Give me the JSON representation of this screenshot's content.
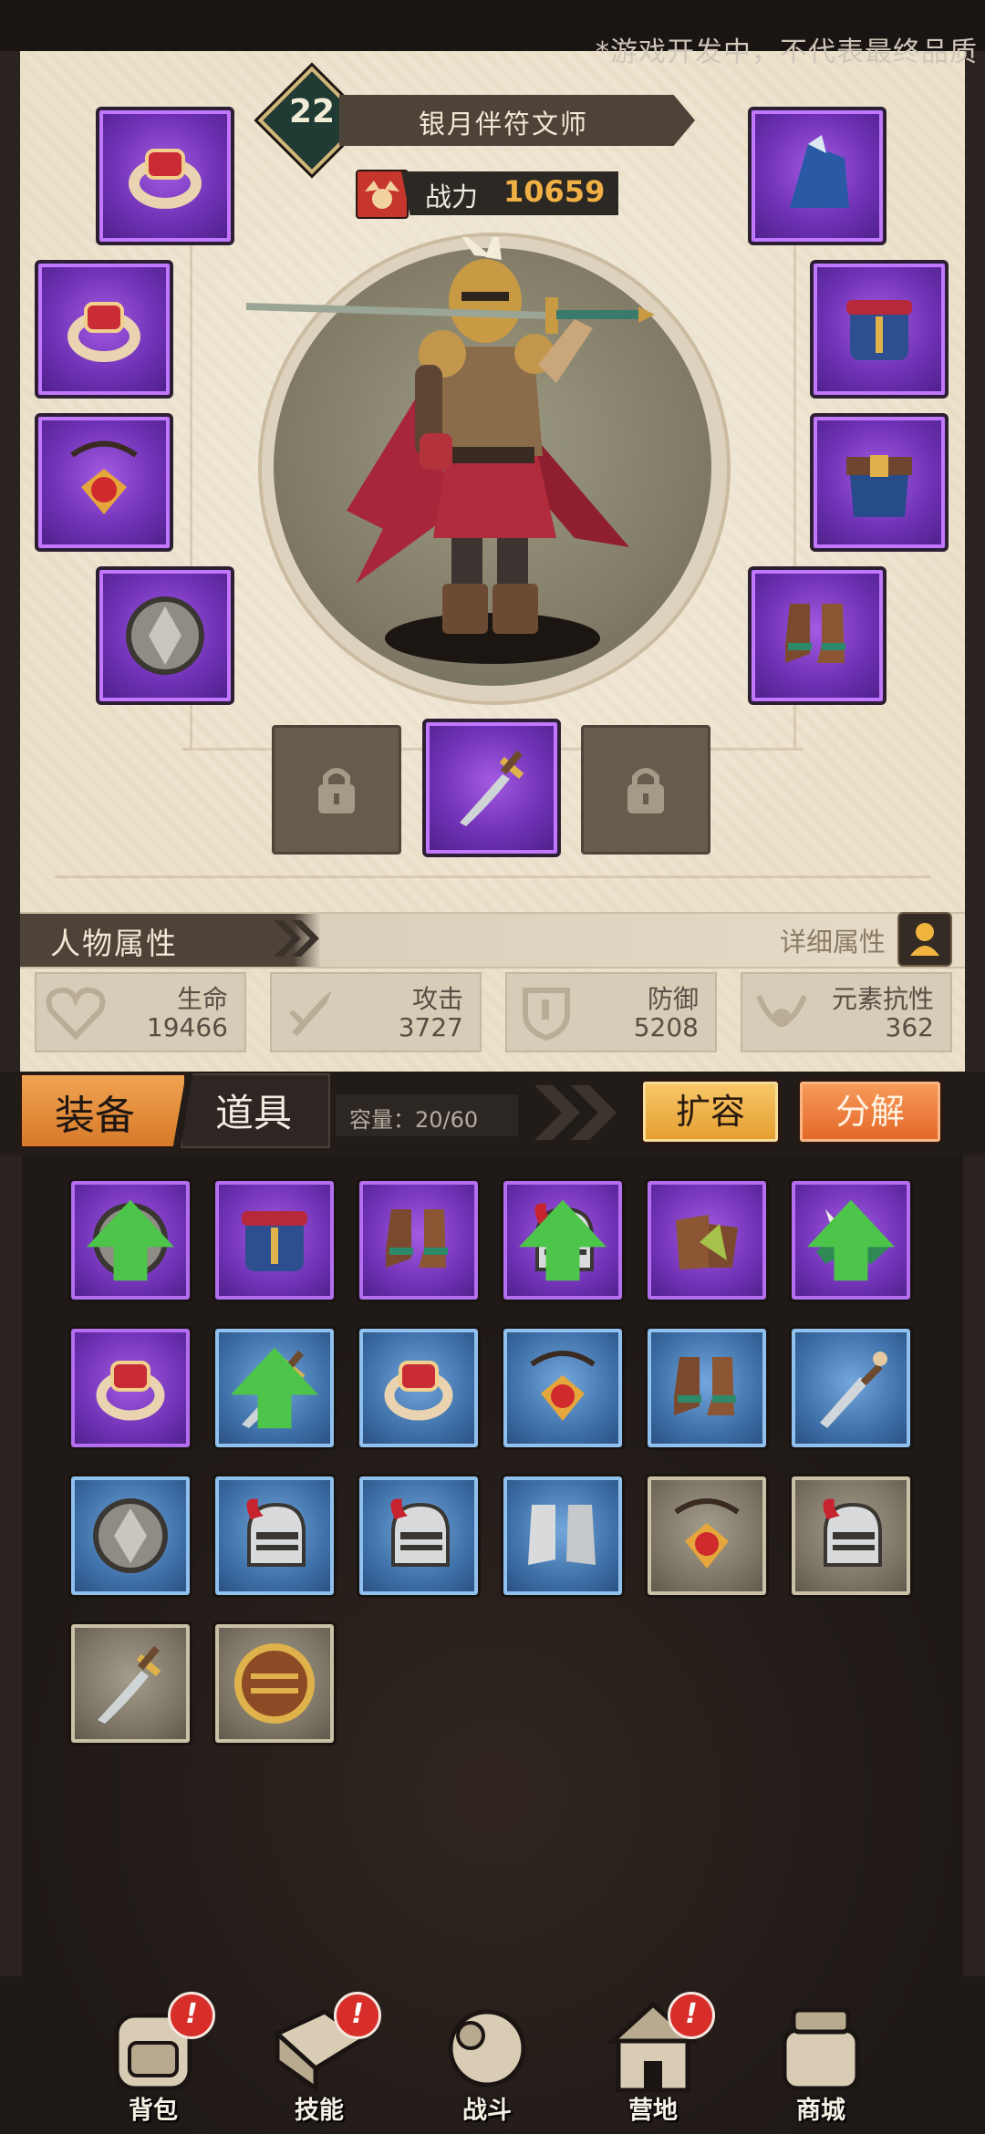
{
  "disclaimer": "*游戏开发中，不代表最终品质",
  "hero": {
    "level": "22",
    "name": "银月伴符文师",
    "power_label": "战力",
    "power_value": "10659"
  },
  "equipment_slots": {
    "left": [
      "ring-icon",
      "ring-icon",
      "amulet-icon",
      "shield-icon"
    ],
    "right": [
      "hood-icon",
      "chest-armor-icon",
      "belt-icon",
      "boots-icon"
    ],
    "bottom": [
      "locked",
      "sword-icon",
      "locked"
    ]
  },
  "attributes": {
    "title": "人物属性",
    "detail_label": "详细属性",
    "stats": [
      {
        "label": "生命",
        "value": "19466",
        "icon": "heart-icon"
      },
      {
        "label": "攻击",
        "value": "3727",
        "icon": "sword-attack-icon"
      },
      {
        "label": "防御",
        "value": "5208",
        "icon": "shield-defense-icon"
      },
      {
        "label": "元素抗性",
        "value": "362",
        "icon": "element-icon"
      }
    ]
  },
  "inventory": {
    "tab_equip": "装备",
    "tab_items": "道具",
    "capacity": "容量：20/60",
    "expand_label": "扩容",
    "decompose_label": "分解",
    "items": [
      {
        "icon": "shield-icon",
        "rarity": "purple",
        "upgrade": true
      },
      {
        "icon": "chest-armor-icon",
        "rarity": "purple",
        "upgrade": false
      },
      {
        "icon": "boots-icon",
        "rarity": "purple",
        "upgrade": false
      },
      {
        "icon": "helmet-icon",
        "rarity": "purple",
        "upgrade": true
      },
      {
        "icon": "gloves-icon",
        "rarity": "purple",
        "upgrade": false
      },
      {
        "icon": "feather-hat-icon",
        "rarity": "purple",
        "upgrade": true
      },
      {
        "icon": "ring-icon",
        "rarity": "purple",
        "upgrade": false
      },
      {
        "icon": "sword-icon",
        "rarity": "blue",
        "upgrade": true
      },
      {
        "icon": "ring-icon",
        "rarity": "blue",
        "upgrade": false
      },
      {
        "icon": "amulet-icon",
        "rarity": "blue",
        "upgrade": false
      },
      {
        "icon": "boots-icon",
        "rarity": "blue",
        "upgrade": false
      },
      {
        "icon": "short-sword-icon",
        "rarity": "blue",
        "upgrade": false
      },
      {
        "icon": "shield-icon",
        "rarity": "blue",
        "upgrade": false
      },
      {
        "icon": "helmet-icon",
        "rarity": "blue",
        "upgrade": false
      },
      {
        "icon": "helmet-icon",
        "rarity": "blue",
        "upgrade": false
      },
      {
        "icon": "plate-boots-icon",
        "rarity": "blue",
        "upgrade": false
      },
      {
        "icon": "amulet-icon",
        "rarity": "gray",
        "upgrade": false
      },
      {
        "icon": "helmet-icon",
        "rarity": "gray",
        "upgrade": false
      },
      {
        "icon": "sword-icon",
        "rarity": "gray",
        "upgrade": false
      },
      {
        "icon": "round-shield-icon",
        "rarity": "gray",
        "upgrade": false
      }
    ]
  },
  "nav": [
    {
      "label": "背包",
      "icon": "backpack-icon",
      "alert": true
    },
    {
      "label": "技能",
      "icon": "skill-book-icon",
      "alert": true
    },
    {
      "label": "战斗",
      "icon": "battle-icon",
      "alert": false
    },
    {
      "label": "营地",
      "icon": "camp-icon",
      "alert": true
    },
    {
      "label": "商城",
      "icon": "shop-icon",
      "alert": false
    }
  ],
  "alert_mark": "!",
  "colors": {
    "parchment": "#ece2cc",
    "dark_bg": "#1f1917",
    "rarity_purple": "#6f31b5",
    "rarity_blue": "#3e6fa8",
    "rarity_gray": "#7c7565",
    "power_value": "#f1b045",
    "button_orange": "#e49d2f",
    "upgrade_green": "#4cc54a"
  }
}
